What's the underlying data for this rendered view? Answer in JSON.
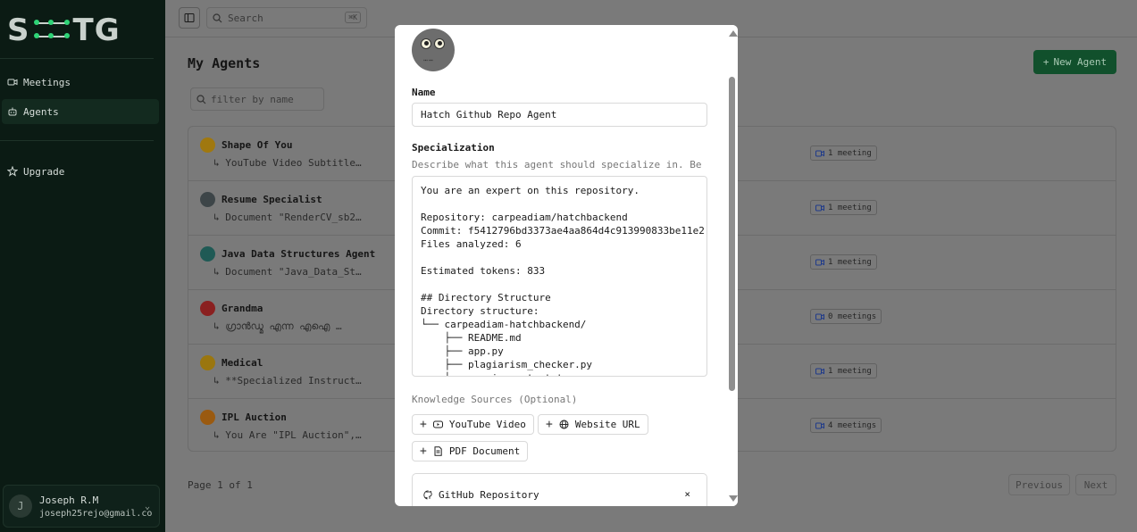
{
  "sidebar": {
    "logo": {
      "pre": "S",
      "post": "TG"
    },
    "nav": [
      {
        "label": "Meetings",
        "icon": "video-icon"
      },
      {
        "label": "Agents",
        "icon": "bot-icon",
        "active": true
      },
      {
        "label": "Upgrade",
        "icon": "upgrade-icon"
      }
    ],
    "user": {
      "initial": "J",
      "name": "Joseph R.M",
      "email": "joseph25rejo@gmail.co"
    }
  },
  "topbar": {
    "search_placeholder": "Search",
    "shortcut": "⌘K"
  },
  "main": {
    "title": "My Agents",
    "new_agent_label": "New Agent",
    "filter_placeholder": "filter by name",
    "agents": [
      {
        "name": "Shape Of You",
        "desc": "↳ YouTube Video Subtitle…",
        "meetings": "1 meeting",
        "color": "#a0780f"
      },
      {
        "name": "Resume Specialist",
        "desc": "↳ Document \"RenderCV_sb2…",
        "meetings": "1 meeting",
        "color": "#3d4548"
      },
      {
        "name": "Java Data Structures Agent",
        "desc": "↳ Document \"Java_Data_St…",
        "meetings": "1 meeting",
        "color": "#1f5a55"
      },
      {
        "name": "Grandma",
        "desc": "↳ ഗ്രാൻഡ്മ എന്ന എഐ …",
        "meetings": "0 meetings",
        "color": "#8a2020"
      },
      {
        "name": "Medical",
        "desc": "↳ **Specialized Instruct…",
        "meetings": "1 meeting",
        "color": "#9a760f"
      },
      {
        "name": "IPL Auction",
        "desc": "↳ You Are \"IPL Auction\",…",
        "meetings": "4 meetings",
        "color": "#9a5a10"
      }
    ],
    "pagination": {
      "text": "Page 1 of 1",
      "previous": "Previous",
      "next": "Next"
    }
  },
  "modal": {
    "name_label": "Name",
    "name_value": "Hatch Github Repo Agent",
    "specialization_label": "Specialization",
    "specialization_hint": "Describe what this agent should specialize in. Be as",
    "specialization_value": "You are an expert on this repository.\n\nRepository: carpeadiam/hatchbackend\nCommit: f5412796bd3373ae4aa864d4c913990833be11e2\nFiles analyzed: 6\n\nEstimated tokens: 833\n\n## Directory Structure\nDirectory structure:\n└── carpeadiam-hatchbackend/\n    ├── README.md\n    ├── app.py\n    ├── plagiarism_checker.py\n    ├── requirements.txt",
    "knowledge_label": "Knowledge Sources (Optional)",
    "sources": {
      "youtube": "YouTube Video",
      "website": "Website URL",
      "pdf": "PDF Document"
    },
    "github_title": "GitHub Repository",
    "github_close": "×"
  },
  "colors": {
    "sidebar_bg": "#0b1b14",
    "accent_green": "#2fd477",
    "new_agent_bg": "#11502c",
    "overlay": "#7a7a7a"
  }
}
